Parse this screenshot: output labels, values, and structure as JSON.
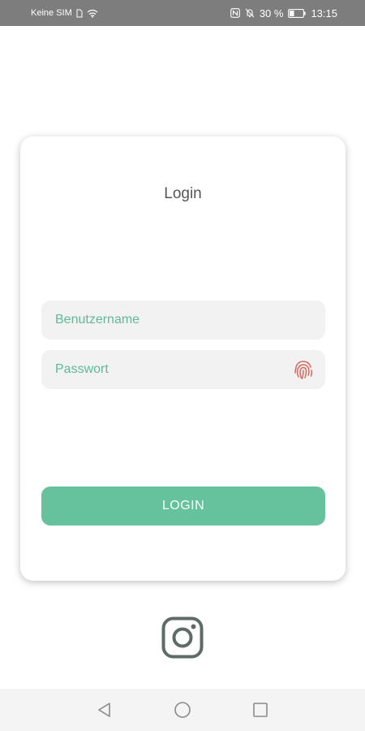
{
  "status_bar": {
    "carrier": "Keine SIM",
    "battery_percent": "30 %",
    "time": "13:15",
    "icons": [
      "sim-icon",
      "wifi-icon",
      "nfc-icon",
      "mute-icon",
      "battery-icon"
    ]
  },
  "login_card": {
    "title": "Login",
    "username": {
      "placeholder": "Benutzername",
      "value": ""
    },
    "password": {
      "placeholder": "Passwort",
      "value": "",
      "icon": "fingerprint-icon"
    },
    "login_button_label": "LOGIN"
  },
  "social": {
    "icon": "instagram-icon"
  },
  "navigation_bar": {
    "icons": [
      "back-icon",
      "home-icon",
      "recent-apps-icon"
    ]
  },
  "colors": {
    "accent": "#66c19d",
    "placeholder": "#5fba98",
    "fingerprint": "#d9665b",
    "status_bar": "#7d7d7d",
    "field_background": "#f2f2f2",
    "instagram_icon": "#5f6b66"
  }
}
